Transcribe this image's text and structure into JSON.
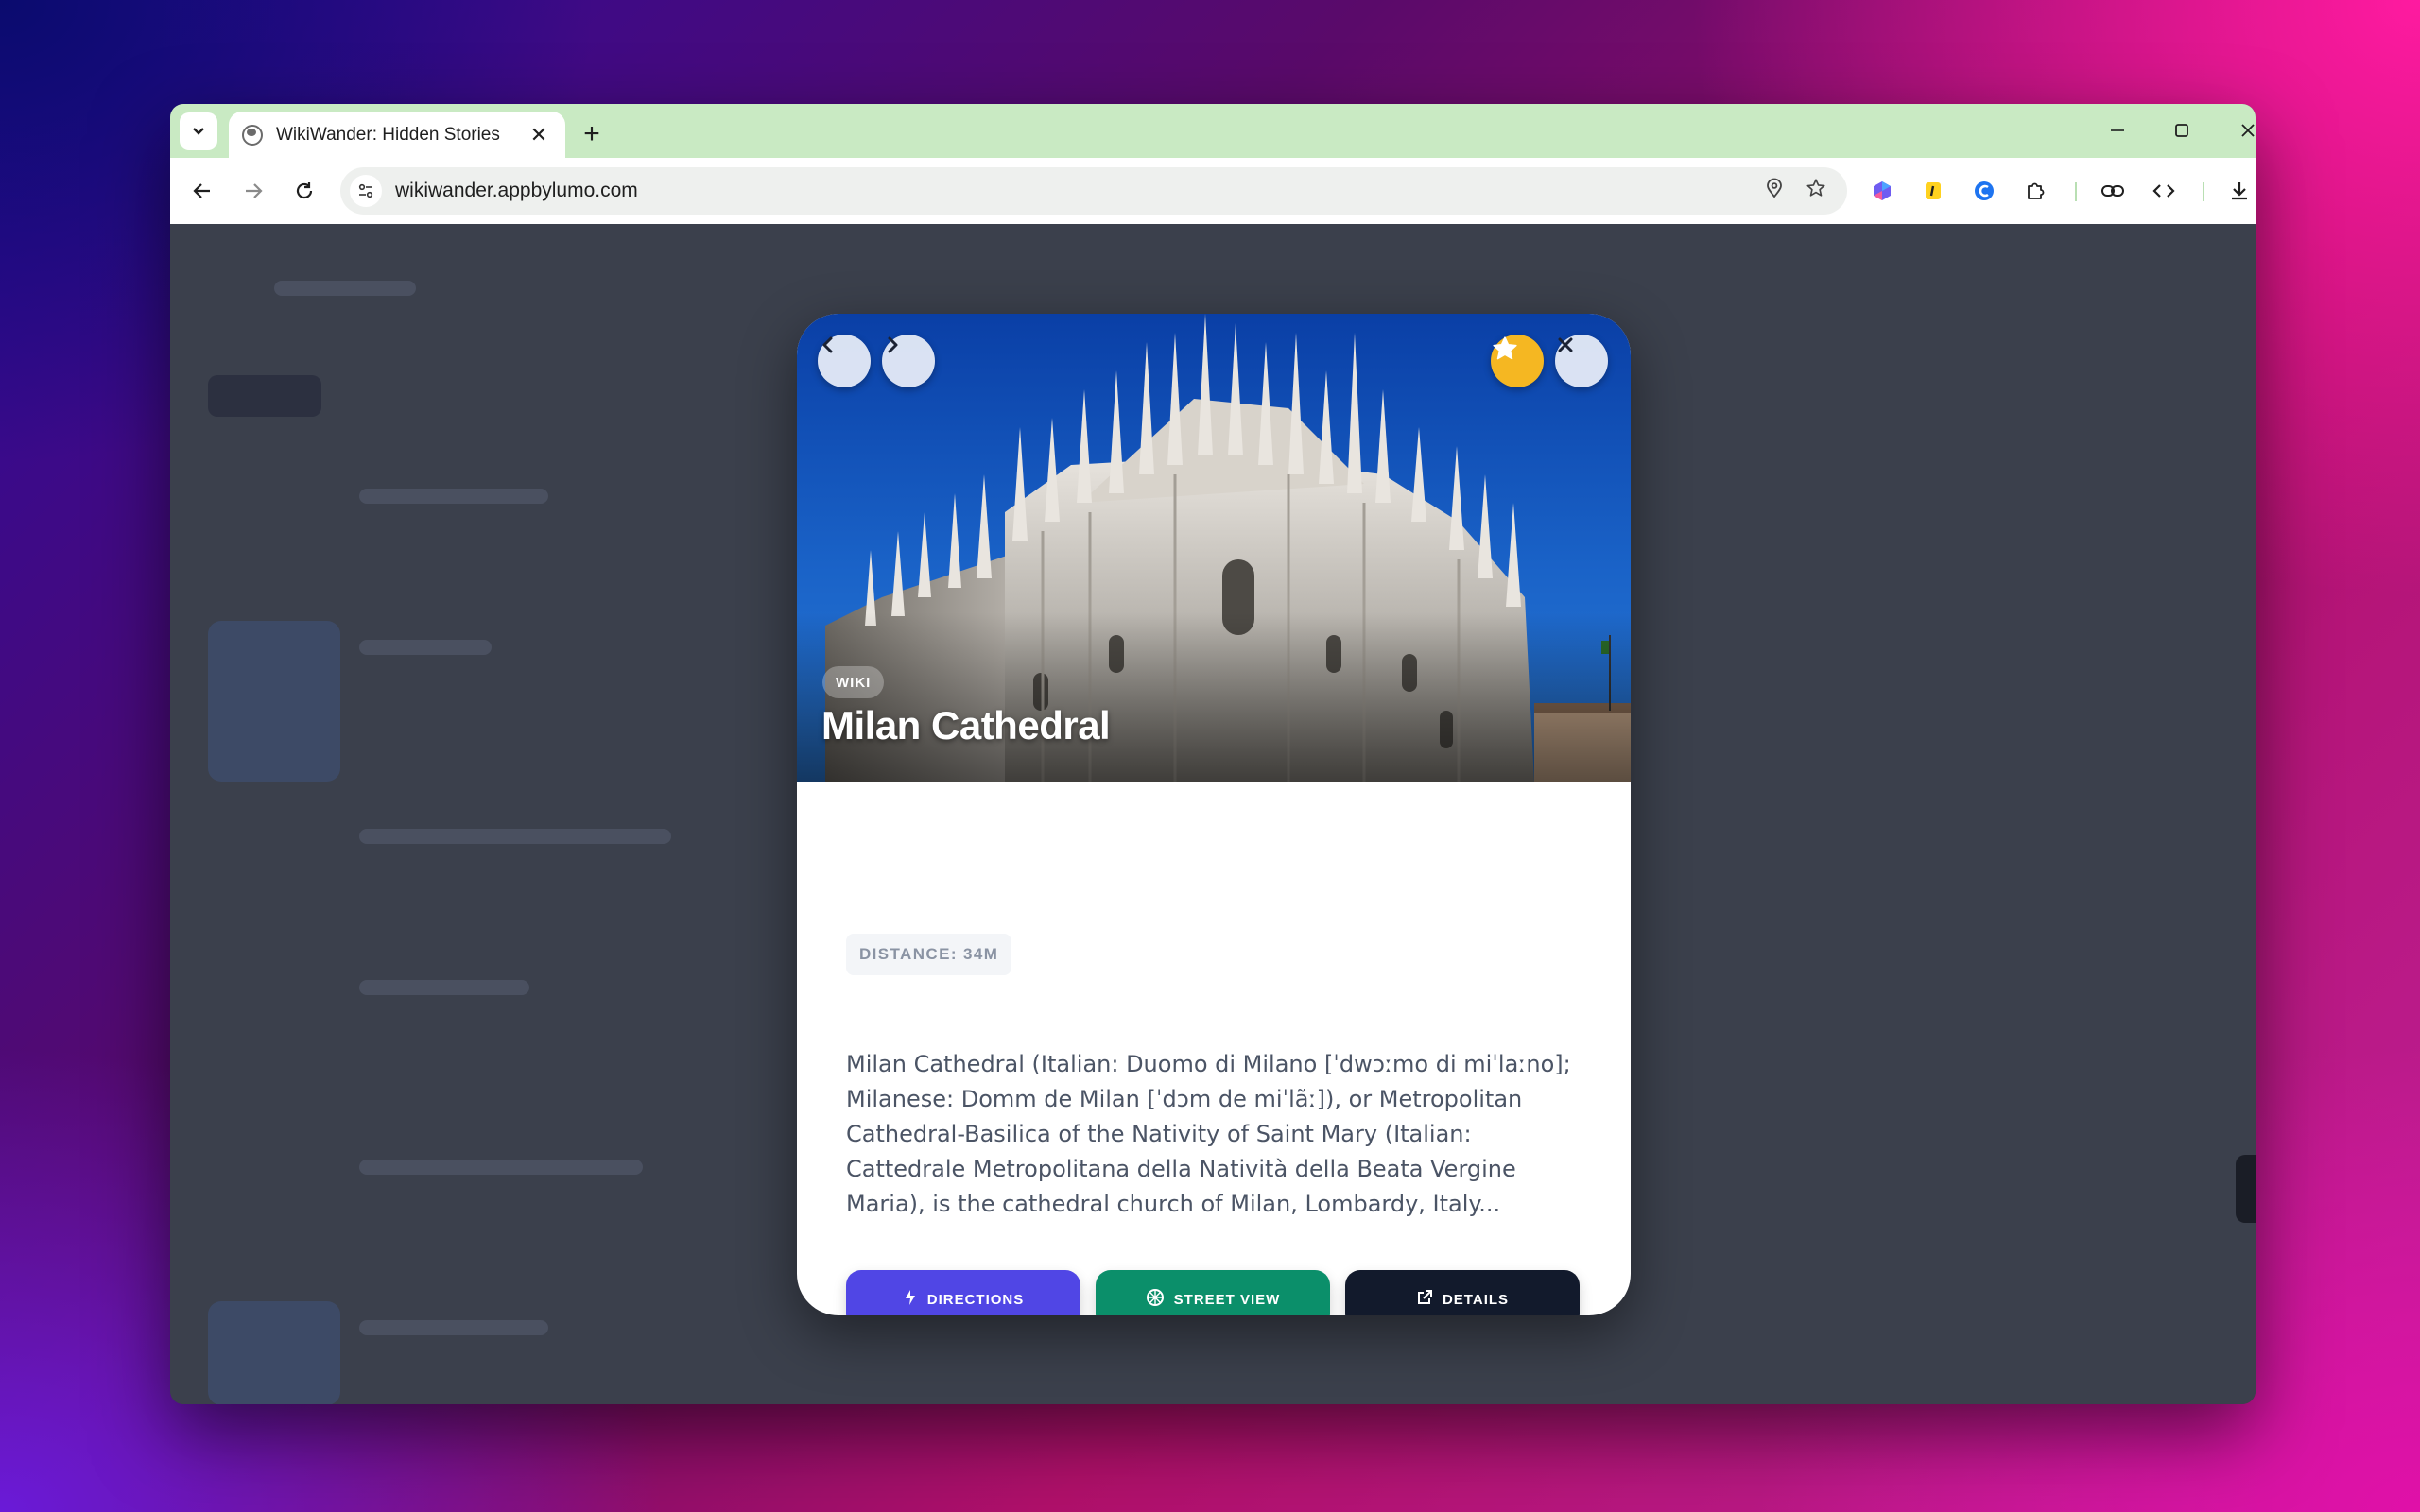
{
  "browser": {
    "tab_title": "WikiWander: Hidden Stories",
    "url": "wikiwander.appbylumo.com"
  },
  "modal": {
    "badge": "WIKI",
    "title": "Milan Cathedral",
    "distance": "DISTANCE: 34M",
    "description": "Milan Cathedral (Italian: Duomo di Milano [ˈdwɔːmo di miˈlaːno]; Milanese: Domm de Milan [ˈdɔm de miˈlãː]), or Metropolitan Cathedral-Basilica of the Nativity of Saint Mary (Italian: Cattedrale Metropolitana della Natività della Beata Vergine Maria), is the cathedral church of Milan, Lombardy, Italy...",
    "actions": {
      "directions": "DIRECTIONS",
      "street_view": "STREET VIEW",
      "details": "DETAILS"
    }
  },
  "colors": {
    "directions": "#5046e5",
    "street_view": "#0b8f6a",
    "details": "#121a2c",
    "star": "#f5b722"
  }
}
